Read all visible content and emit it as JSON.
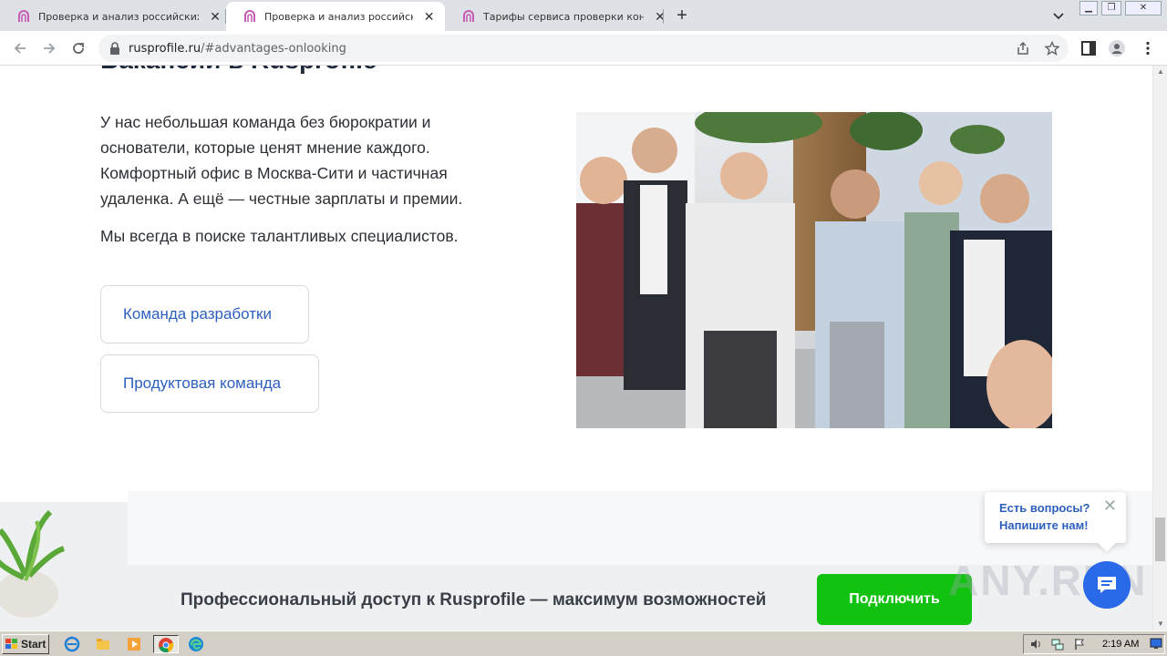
{
  "browser": {
    "tabs": [
      {
        "title": "Проверка и анализ российских юр",
        "active": false
      },
      {
        "title": "Проверка и анализ российских юр",
        "active": true
      },
      {
        "title": "Тарифы сервиса проверки контра",
        "active": false
      }
    ],
    "new_tab_label": "+",
    "address": {
      "host": "rusprofile.ru",
      "path": "/#advantages-onlooking"
    },
    "accent_color": "#1a73e8"
  },
  "page": {
    "heading": "Вакансии в Rusprofile",
    "paragraph1": "У нас небольшая команда без бюрократии и основатели, которые ценят мнение каждого. Комфортный офис в Москва-Сити и частичная удаленка. А ещё — честные зарплаты и премии.",
    "paragraph2": "Мы всегда в поиске талантливых специалистов.",
    "team_buttons": {
      "dev": "Команда разработки",
      "product": "Продуктовая команда"
    },
    "link_color": "#2d5fbf"
  },
  "promo": {
    "text": "Профессиональный доступ к Rusprofile — максимум возможностей",
    "button": "Подключить",
    "button_color": "#11c211"
  },
  "chat": {
    "line1": "Есть вопросы?",
    "line2": "Напишите нам!",
    "close": "✕"
  },
  "watermark": "ANY.RUN",
  "taskbar": {
    "start_label": "Start",
    "clock": "2:19 AM"
  }
}
